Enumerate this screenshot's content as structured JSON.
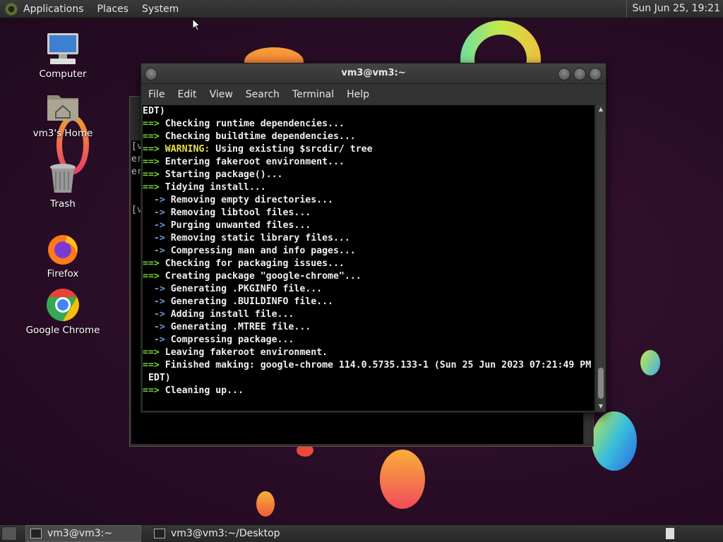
{
  "top_panel": {
    "menus": [
      "Applications",
      "Places",
      "System"
    ],
    "clock": "Sun Jun 25, 19:21"
  },
  "desktop_icons": [
    {
      "label": "Computer",
      "icon": "computer-icon"
    },
    {
      "label": "vm3's Home",
      "icon": "home-folder-icon"
    },
    {
      "label": "Trash",
      "icon": "trash-icon"
    },
    {
      "label": "Firefox",
      "icon": "firefox-icon"
    },
    {
      "label": "Google Chrome",
      "icon": "chrome-icon"
    }
  ],
  "back_terminal": {
    "visible_text": [
      "[v",
      "er",
      "er",
      "",
      "",
      "[v"
    ]
  },
  "terminal": {
    "title": "vm3@vm3:~",
    "menu": [
      "File",
      "Edit",
      "View",
      "Search",
      "Terminal",
      "Help"
    ],
    "lines": [
      {
        "prefix": "",
        "text": "EDT)"
      },
      {
        "prefix": "==>",
        "text": " Checking runtime dependencies..."
      },
      {
        "prefix": "==>",
        "text": " Checking buildtime dependencies..."
      },
      {
        "prefix": "==>",
        "warn": " WARNING:",
        "text": " Using existing $srcdir/ tree"
      },
      {
        "prefix": "==>",
        "text": " Entering fakeroot environment..."
      },
      {
        "prefix": "==>",
        "text": " Starting package()..."
      },
      {
        "prefix": "==>",
        "text": " Tidying install..."
      },
      {
        "sub": "  ->",
        "text": " Removing empty directories..."
      },
      {
        "sub": "  ->",
        "text": " Removing libtool files..."
      },
      {
        "sub": "  ->",
        "text": " Purging unwanted files..."
      },
      {
        "sub": "  ->",
        "text": " Removing static library files..."
      },
      {
        "sub": "  ->",
        "text": " Compressing man and info pages..."
      },
      {
        "prefix": "==>",
        "text": " Checking for packaging issues..."
      },
      {
        "prefix": "==>",
        "text": " Creating package \"google-chrome\"..."
      },
      {
        "sub": "  ->",
        "text": " Generating .PKGINFO file..."
      },
      {
        "sub": "  ->",
        "text": " Generating .BUILDINFO file..."
      },
      {
        "sub": "  ->",
        "text": " Adding install file..."
      },
      {
        "sub": "  ->",
        "text": " Generating .MTREE file..."
      },
      {
        "sub": "  ->",
        "text": " Compressing package..."
      },
      {
        "prefix": "==>",
        "text": " Leaving fakeroot environment."
      },
      {
        "prefix": "==>",
        "text": " Finished making: google-chrome 114.0.5735.133-1 (Sun 25 Jun 2023 07:21:49 PM"
      },
      {
        "prefix": "",
        "text": " EDT)"
      },
      {
        "prefix": "==>",
        "text": " Cleaning up..."
      }
    ]
  },
  "taskbar": {
    "tasks": [
      {
        "label": "vm3@vm3:~",
        "active": true
      },
      {
        "label": "vm3@vm3:~/Desktop",
        "active": false
      }
    ]
  },
  "colors": {
    "arrow_green": "#7bd33a",
    "sub_arrow_blue": "#6f9bd8",
    "warning_yellow": "#e8e24b",
    "terminal_bg": "#000000"
  }
}
